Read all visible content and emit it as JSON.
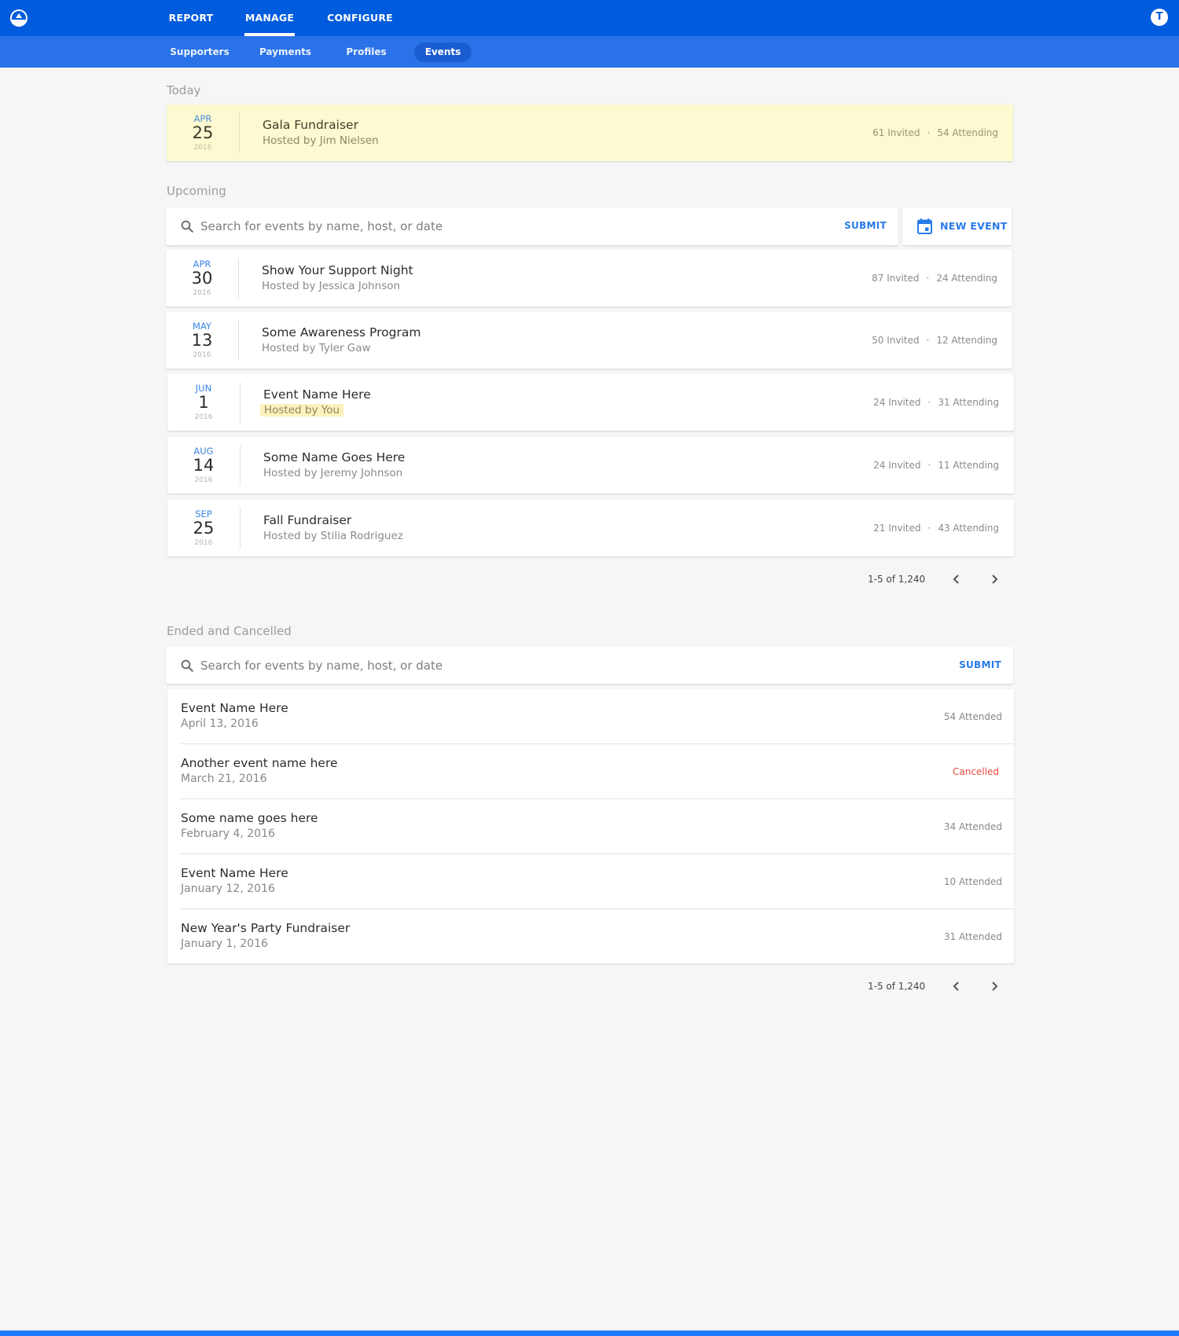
{
  "nav": {
    "logo": "app-logo-icon",
    "main_tabs": [
      {
        "label": "REPORT",
        "active": false
      },
      {
        "label": "MANAGE",
        "active": true
      },
      {
        "label": "CONFIGURE",
        "active": false
      }
    ],
    "avatar_initial": "T",
    "sub_tabs": [
      {
        "label": "Supporters",
        "active": false
      },
      {
        "label": "Payments",
        "active": false
      },
      {
        "label": "Profiles",
        "active": false
      },
      {
        "label": "Events",
        "active": true
      }
    ]
  },
  "colors": {
    "primary": "#015bdd",
    "subnav": "#2a72e8",
    "accent": "#2a7ae8",
    "today_bg": "#fdf9d0",
    "cancelled": "#e84b3c"
  },
  "today": {
    "label": "Today",
    "event": {
      "month": "APR",
      "day": "25",
      "year": "2016",
      "name": "Gala Fundraiser",
      "host": "Hosted by Jim Nielsen",
      "invited": "61 Invited",
      "attending": "54 Attending"
    }
  },
  "upcoming": {
    "label": "Upcoming",
    "search_placeholder": "Search for events by name, host, or date",
    "submit_label": "SUBMIT",
    "new_event_label": "NEW EVENT",
    "events": [
      {
        "month": "APR",
        "day": "30",
        "year": "2016",
        "name": "Show Your Support Night",
        "host": "Hosted by Jessica Johnson",
        "invited": "87 Invited",
        "attending": "24 Attending",
        "hosted_by_you": false
      },
      {
        "month": "MAY",
        "day": "13",
        "year": "2016",
        "name": "Some Awareness Program",
        "host": "Hosted by Tyler Gaw",
        "invited": "50 Invited",
        "attending": "12 Attending",
        "hosted_by_you": false
      },
      {
        "month": "JUN",
        "day": "1",
        "year": "2016",
        "name": "Event Name Here",
        "host": "Hosted by You",
        "invited": "24 Invited",
        "attending": "31 Attending",
        "hosted_by_you": true
      },
      {
        "month": "AUG",
        "day": "14",
        "year": "2016",
        "name": "Some Name Goes Here",
        "host": "Hosted by Jeremy Johnson",
        "invited": "24 Invited",
        "attending": "11 Attending",
        "hosted_by_you": false
      },
      {
        "month": "SEP",
        "day": "25",
        "year": "2016",
        "name": "Fall Fundraiser",
        "host": "Hosted by Stilia Rodriguez",
        "invited": "21 Invited",
        "attending": "43 Attending",
        "hosted_by_you": false
      }
    ],
    "pagination": "1-5 of 1,240"
  },
  "ended": {
    "label": "Ended and Cancelled",
    "search_placeholder": "Search for events by name, host, or date",
    "submit_label": "SUBMIT",
    "events": [
      {
        "name": "Event Name Here",
        "date": "April 13, 2016",
        "status": "54 Attended",
        "cancelled": false
      },
      {
        "name": "Another event name here",
        "date": "March 21, 2016",
        "status": "Cancelled",
        "cancelled": true
      },
      {
        "name": "Some name goes here",
        "date": "February 4, 2016",
        "status": "34 Attended",
        "cancelled": false
      },
      {
        "name": "Event Name Here",
        "date": "January 12, 2016",
        "status": "10 Attended",
        "cancelled": false
      },
      {
        "name": "New Year's Party Fundraiser",
        "date": "January 1, 2016",
        "status": "31 Attended",
        "cancelled": false
      }
    ],
    "pagination": "1-5 of 1,240"
  }
}
